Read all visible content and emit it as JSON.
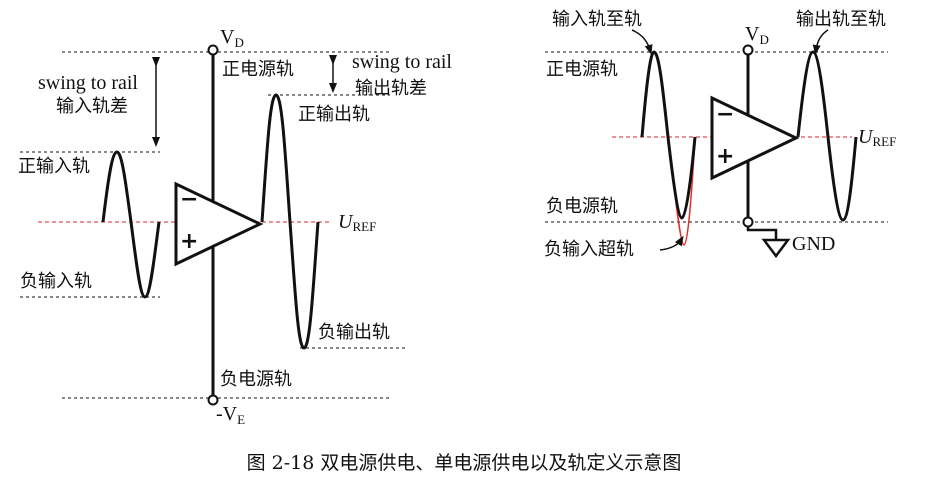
{
  "left": {
    "vd": "V",
    "vd_sub": "D",
    "ve": "-V",
    "ve_sub": "E",
    "pos_supply": "正电源轨",
    "neg_supply": "负电源轨",
    "pos_input": "正输入轨",
    "neg_input": "负输入轨",
    "pos_output": "正输出轨",
    "neg_output": "负输出轨",
    "swing_in_en": "swing to rail",
    "swing_in_cn": "输入轨差",
    "swing_out_en": "swing to rail",
    "swing_out_cn": "输出轨差",
    "uref": "U",
    "uref_sub": "REF",
    "minus": "−",
    "plus": "+"
  },
  "right": {
    "vd": "V",
    "vd_sub": "D",
    "pos_supply": "正电源轨",
    "neg_supply": "负电源轨",
    "in_rail_to_rail": "输入轨至轨",
    "out_rail_to_rail": "输出轨至轨",
    "neg_input_over": "负输入超轨",
    "gnd": "GND",
    "uref": "U",
    "uref_sub": "REF",
    "minus": "−",
    "plus": "+"
  },
  "caption": "图 2-18  双电源供电、单电源供电以及轨定义示意图",
  "colors": {
    "line": "#111111",
    "ref_line": "#d9262a",
    "over_rail": "#e0302e"
  }
}
